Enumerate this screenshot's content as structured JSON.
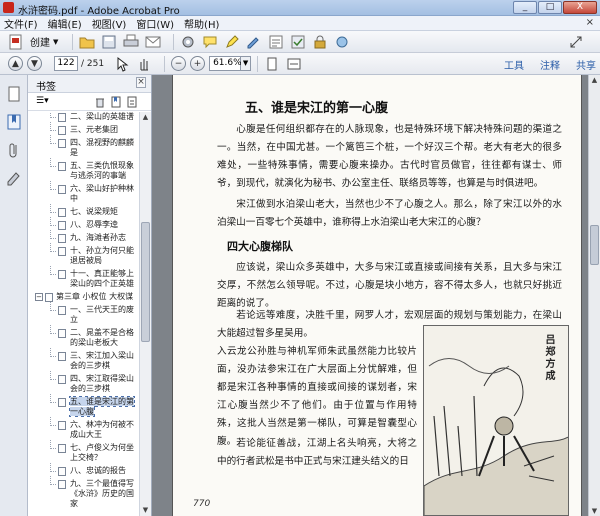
{
  "window": {
    "title": "水浒密码.pdf - Adobe Acrobat Pro",
    "controls": [
      "_",
      "□",
      "X"
    ]
  },
  "menu": [
    "文件(F)",
    "编辑(E)",
    "视图(V)",
    "窗口(W)",
    "帮助(H)"
  ],
  "menu_close": "×",
  "toolbar": {
    "create_label": "创建",
    "create_arrow": "▼"
  },
  "nav": {
    "page_current": "122",
    "page_total": "/ 251",
    "zoom": "61.6%",
    "links": [
      "工具",
      "注释",
      "共享"
    ]
  },
  "bookmarks": {
    "title": "书签",
    "options_label": "☰▾",
    "items": [
      {
        "label": "二、梁山的英雄谱",
        "level": 2
      },
      {
        "label": "三、元老集团",
        "level": 2
      },
      {
        "label": "四、混视野的麒麟是",
        "level": 2
      },
      {
        "label": "五、三类仇恨现象与逃杀河的事端",
        "level": 2
      },
      {
        "label": "六、梁山好护种林中",
        "level": 2
      },
      {
        "label": "七、说梁规矩",
        "level": 2
      },
      {
        "label": "八、忍辱李逵",
        "level": 2
      },
      {
        "label": "九、海滩者孙志",
        "level": 2
      },
      {
        "label": "十、孙立为何只能退居被局",
        "level": 2
      },
      {
        "label": "十一、真正能够上梁山的四个正英雄",
        "level": 2
      },
      {
        "label": "第三章 小权位 大权谋",
        "level": 1
      },
      {
        "label": "一、三代天王的废立",
        "level": 2
      },
      {
        "label": "二、晁盖不是合格的梁山老板大",
        "level": 2
      },
      {
        "label": "三、宋江加入梁山会的三步棋",
        "level": 2
      },
      {
        "label": "四、宋江取得梁山会的三步棋",
        "level": 2
      },
      {
        "label": "五、谁是宋江的第一心腹",
        "level": 2,
        "selected": true
      },
      {
        "label": "六、林冲为何被不成山大王",
        "level": 2
      },
      {
        "label": "七、卢俊义为何坐上交椅？",
        "level": 2
      },
      {
        "label": "八、忠诚的报告",
        "level": 2
      },
      {
        "label": "九、三个最值得写《水浒》历史的国家",
        "level": 2
      }
    ]
  },
  "document": {
    "section_title": "五、谁是宋江的第一心腹",
    "para1": "心腹是任何组织都存在的人脉现象，也是特殊环境下解决特殊问题的渠道之一。当然，在中国尤甚。一个篱笆三个桩，一个好汉三个帮。老大有老大的很多难处，一些特殊事情，需要心腹来操办。古代时官员做官，往往都有谋士、师爷，到现代，就演化为秘书、办公室主任、联络员等等，也算是与时俱进吧。",
    "para2": "宋江做到水泊梁山老大，当然也少不了心腹之人。那么，除了宋江以外的水泊梁山一百零七个英雄中，谁称得上水泊梁山老大宋江的心腹？",
    "subsection_title": "四大心腹梯队",
    "para3": "应该说，梁山众多英雄中，大多与宋江或直接或间接有关系，且大多与宋江交厚，不然怎么领导呢。不过，心腹是块小地方，容不得太多人，也就只好挑近距离的说了。",
    "para4": "若论远等难度，决胜千里，网罗人才，宏观层面的规划与策划能力，在梁山大能超过智多星吴用。",
    "para5": "入云龙公孙胜与神机军师朱武虽然能力比较片面，没办法参宋江在广大层面上分忧解难，但都是宋江各种事情的直接或间接的谋划者，宋江心腹当然少不了他们。由于位置与作用特殊，这批人当然是第一梯队，可算是智囊型心腹。",
    "para6": "若论能征善战，江湖上名头响亮，大将之中的行者武松是书中正式与宋江建头结义的日",
    "illustration_caption": "吕郑方成",
    "page_number": "770"
  }
}
